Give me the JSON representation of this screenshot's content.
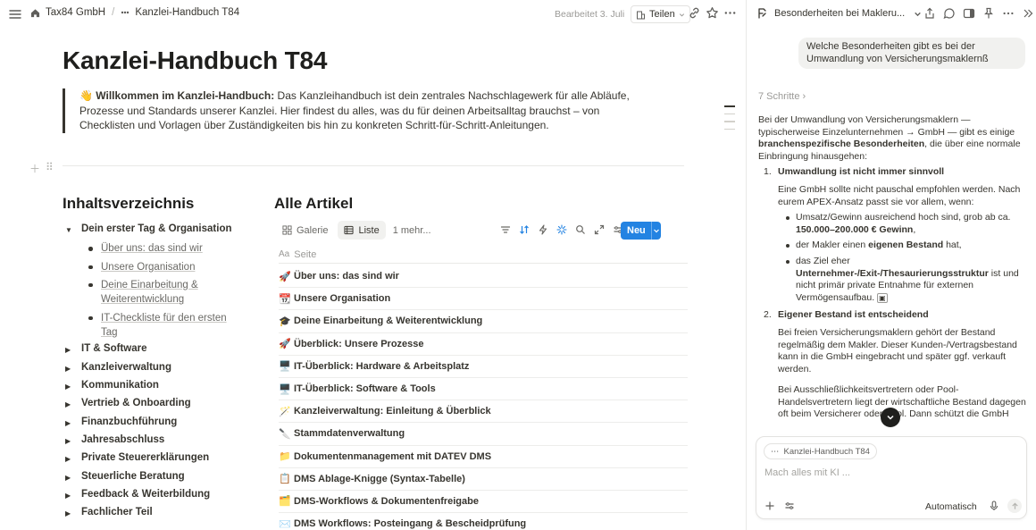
{
  "breadcrumb": {
    "workspace": "Tax84 GmbH",
    "page": "Kanzlei-Handbuch T84"
  },
  "topbar": {
    "edited": "Bearbeitet 3. Juli",
    "share_label": "Teilen"
  },
  "page": {
    "title": "Kanzlei-Handbuch T84",
    "intro_emoji": "👋",
    "intro_bold": "Willkommen im Kanzlei-Handbuch:",
    "intro_text": " Das Kanzleihandbuch ist dein zentrales Nachschlagewerk für alle Abläufe, Prozesse und Standards unserer Kanzlei. Hier findest du alles, was du für deinen Arbeitsalltag brauchst – von Checklisten und Vorlagen über Zuständigkeiten bis hin zu konkreten Schritt-für-Schritt-Anleitungen."
  },
  "toc": {
    "heading": "Inhaltsverzeichnis",
    "open_item": "Dein erster Tag & Organisation",
    "sub_items": [
      "Über uns: das sind wir",
      "Unsere Organisation",
      "Deine Einarbeitung & Weiterentwicklung",
      "IT-Checkliste für den ersten Tag"
    ],
    "items": [
      "IT & Software",
      "Kanzleiverwaltung",
      "Kommunikation",
      "Vertrieb & Onboarding",
      "Finanzbuchführung",
      "Jahresabschluss",
      "Private Steuererklärungen",
      "Steuerliche Beratung",
      "Feedback & Weiterbildung",
      "Fachlicher Teil"
    ]
  },
  "articles": {
    "heading": "Alle Artikel",
    "views": {
      "gallery": "Galerie",
      "list": "Liste",
      "more": "1 mehr..."
    },
    "new_label": "Neu",
    "column": "Seite",
    "rows": [
      {
        "emoji": "🚀",
        "title": "Über uns: das sind wir"
      },
      {
        "emoji": "📆",
        "title": "Unsere Organisation"
      },
      {
        "emoji": "🎓",
        "title": "Deine Einarbeitung & Weiterentwicklung"
      },
      {
        "emoji": "🚀",
        "title": "Überblick: Unsere Prozesse"
      },
      {
        "emoji": "🖥️",
        "title": "IT-Überblick: Hardware & Arbeitsplatz"
      },
      {
        "emoji": "🖥️",
        "title": "IT-Überblick: Software & Tools"
      },
      {
        "emoji": "🪄",
        "title": "Kanzleiverwaltung: Einleitung & Überblick"
      },
      {
        "emoji": "🔪",
        "title": "Stammdatenverwaltung"
      },
      {
        "emoji": "📁",
        "title": "Dokumentenmanagement mit DATEV DMS"
      },
      {
        "emoji": "📋",
        "title": "DMS Ablage-Knigge (Syntax-Tabelle)"
      },
      {
        "emoji": "🗂️",
        "title": "DMS-Workflows & Dokumentenfreigabe"
      },
      {
        "emoji": "✉️",
        "title": "DMS Workflows: Posteingang & Bescheidprüfung"
      }
    ]
  },
  "ai": {
    "chat_title": "Besonderheiten bei Makleru...",
    "user_message": "Welche Besonderheiten gibt es bei der Umwandlung von Versicherungsmaklernß",
    "steps": "7 Schritte",
    "intro_1": "Bei der Umwandlung von Versicherungsmaklern — typischerweise Einzelunternehmen → GmbH — gibt es einige ",
    "intro_bold": "branchenspezifische Besonderheiten",
    "intro_2": ", die über eine normale Einbringung hinausgehen:",
    "point1_title": "Umwandlung ist nicht immer sinnvoll",
    "point1_text": "Eine GmbH sollte nicht pauschal empfohlen werden. Nach eurem APEX-Ansatz passt sie vor allem, wenn:",
    "b1_text": "Umsatz/Gewinn ausreichend hoch sind, grob ab ca. ",
    "b1_bold": "150.000–200.000 € Gewinn",
    "b1_end": ",",
    "b2_text": "der Makler einen ",
    "b2_bold": "eigenen Bestand",
    "b2_end": " hat,",
    "b3_text": "das Ziel eher ",
    "b3_bold": "Unternehmer-/Exit-/Thesaurierungsstruktur",
    "b3_end": " ist und nicht primär private Entnahme für externen Vermögensaufbau.",
    "point2_title": "Eigener Bestand ist entscheidend",
    "point2_text": "Bei freien Versicherungsmaklern gehört der Bestand regelmäßig dem Makler. Dieser Kunden-/Vertragsbestand kann in die GmbH eingebracht und später ggf. verkauft werden.",
    "point2_text2": "Bei Ausschließlichkeitsvertretern oder Pool-Handelsvertretern liegt der wirtschaftliche Bestand dagegen oft beim Versicherer oder Pool. Dann schützt die GmbH",
    "context_chip": "Kanzlei-Handbuch T84",
    "placeholder": "Mach alles mit KI ...",
    "mode": "Automatisch"
  },
  "colors": {
    "accent": "#2383e2",
    "text": "#37352f",
    "muted": "#9b9a97"
  }
}
